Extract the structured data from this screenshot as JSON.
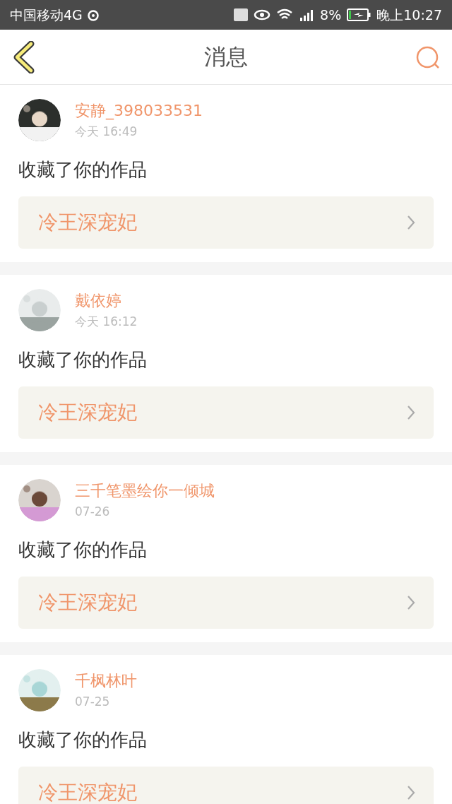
{
  "status_bar": {
    "carrier": "中国移动4G",
    "battery_percent": "8%",
    "time": "晚上10:27"
  },
  "header": {
    "title": "消息"
  },
  "messages": [
    {
      "user": "安静_398033531",
      "time": "今天 16:49",
      "action": "收藏了你的作品",
      "work": "冷王深宠妃"
    },
    {
      "user": "戴依婷",
      "time": "今天 16:12",
      "action": "收藏了你的作品",
      "work": "冷王深宠妃"
    },
    {
      "user": "三千笔墨绘你一倾城",
      "time": "07-26",
      "action": "收藏了你的作品",
      "work": "冷王深宠妃"
    },
    {
      "user": "千枫林叶",
      "time": "07-25",
      "action": "收藏了你的作品",
      "work": "冷王深宠妃"
    }
  ]
}
